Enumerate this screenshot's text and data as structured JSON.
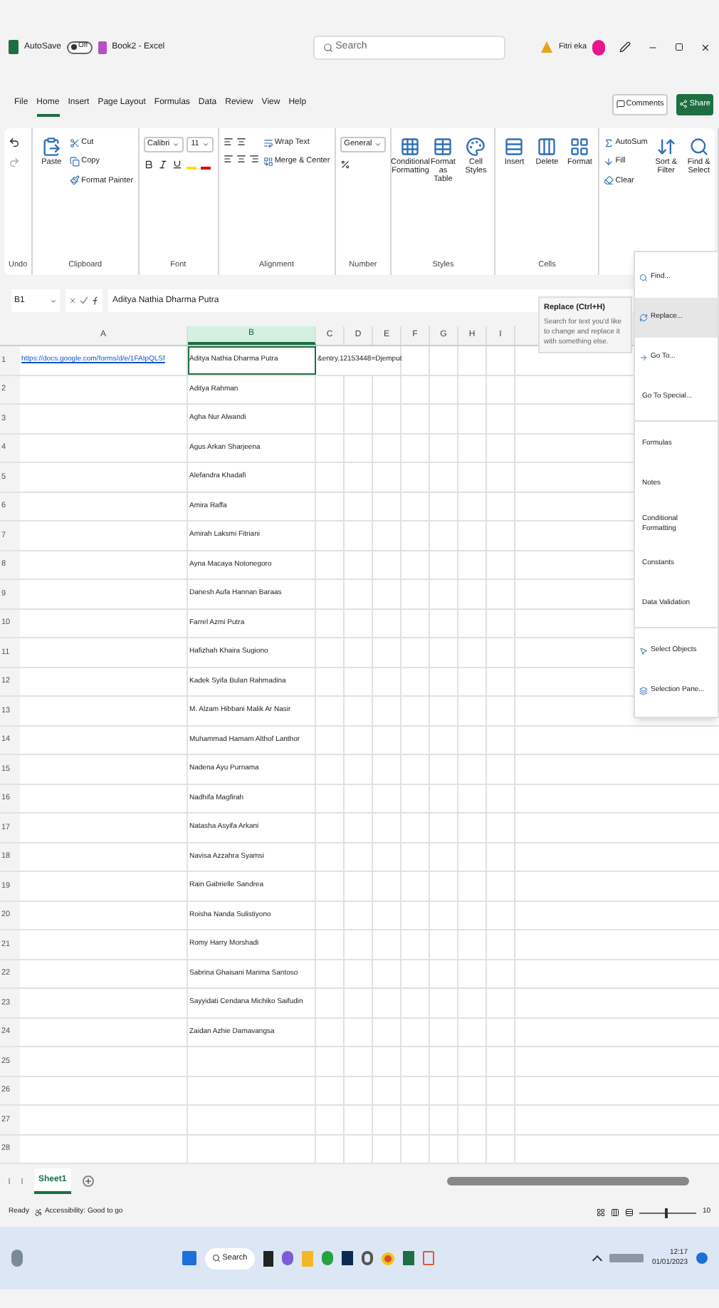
{
  "title_bar": {
    "autosave_label": "AutoSave",
    "autosave_on": false,
    "toggle_text": "Off",
    "document": "Book2 - Excel",
    "search_placeholder": "Search",
    "user": "Fitri eka"
  },
  "menu_tabs": [
    {
      "label": "File",
      "selected": false
    },
    {
      "label": "Home",
      "selected": true
    },
    {
      "label": "Insert",
      "selected": false
    },
    {
      "label": "Page Layout",
      "selected": false
    },
    {
      "label": "Formulas",
      "selected": false
    },
    {
      "label": "Data",
      "selected": false
    },
    {
      "label": "Review",
      "selected": false
    },
    {
      "label": "View",
      "selected": false
    },
    {
      "label": "Help",
      "selected": false
    }
  ],
  "comments_button": "Comments",
  "share_button": "Share",
  "ribbon_groups": [
    {
      "label": "Undo"
    },
    {
      "label": "Clipboard",
      "items": [
        {
          "label": "Paste",
          "kind": "large"
        },
        {
          "label": "Cut",
          "kind": "small"
        },
        {
          "label": "Copy",
          "kind": "small"
        },
        {
          "label": "Format Painter",
          "kind": "small"
        }
      ]
    },
    {
      "label": "Font",
      "items": [
        {
          "label": "Calibri",
          "kind": "field"
        },
        {
          "label": "11",
          "kind": "field"
        }
      ]
    },
    {
      "label": "Alignment",
      "items": [
        {
          "label": "Wrap Text",
          "kind": "small"
        },
        {
          "label": "Merge & Center",
          "kind": "small"
        }
      ]
    },
    {
      "label": "Number",
      "items": [
        {
          "label": "General",
          "kind": "field"
        }
      ]
    },
    {
      "label": "Styles",
      "items": [
        {
          "label": "Conditional Formatting",
          "kind": "large"
        },
        {
          "label": "Format as Table",
          "kind": "large"
        },
        {
          "label": "Cell Styles",
          "kind": "large"
        }
      ]
    },
    {
      "label": "Cells",
      "items": [
        {
          "label": "Insert",
          "kind": "large"
        },
        {
          "label": "Delete",
          "kind": "large"
        },
        {
          "label": "Format",
          "kind": "large"
        }
      ]
    },
    {
      "items": [
        {
          "label": "AutoSum",
          "kind": "small"
        },
        {
          "label": "Fill",
          "kind": "small"
        },
        {
          "label": "Clear",
          "kind": "small"
        },
        {
          "label": "Sort & Filter",
          "kind": "large"
        },
        {
          "label": "Find & Select",
          "kind": "large"
        }
      ]
    }
  ],
  "formula_bar": {
    "cell_ref": "B1",
    "value": "Aditya Nathia Dharma Putra"
  },
  "columns": [
    {
      "label": "A",
      "selected": false
    },
    {
      "label": "B",
      "selected": true
    },
    {
      "label": "C",
      "selected": false
    },
    {
      "label": "D",
      "selected": false
    },
    {
      "label": "E",
      "selected": false
    },
    {
      "label": "F",
      "selected": false
    },
    {
      "label": "G",
      "selected": false
    },
    {
      "label": "H",
      "selected": false
    },
    {
      "label": "I",
      "selected": false
    }
  ],
  "rows": [
    {
      "number": "1",
      "a": "https://docs.google.com/forms/d/e/1FAIpQLSf",
      "b": "Aditya Nathia Dharma Putra",
      "c": "&entry.12153448=Djemput",
      "active": true
    },
    {
      "number": "2",
      "b": "Aditya Rahman",
      "active": false
    },
    {
      "number": "3",
      "b": "Agha Nur Alwandi",
      "active": false
    },
    {
      "number": "4",
      "b": "Agus Arkan Sharjeena",
      "active": false
    },
    {
      "number": "5",
      "b": "Alefandra Khadafi",
      "active": false
    },
    {
      "number": "6",
      "b": "Amira Raffa",
      "active": false
    },
    {
      "number": "7",
      "b": "Amirah Laksmi Fitriani",
      "active": false
    },
    {
      "number": "8",
      "b": "Ayna Macaya Notonegoro",
      "active": false
    },
    {
      "number": "9",
      "b": "Danesh Aufa Hannan Baraas",
      "active": false
    },
    {
      "number": "10",
      "b": "Farrel Azmi Putra",
      "active": false
    },
    {
      "number": "11",
      "b": "Hafizhah Khaira Sugiono",
      "active": false
    },
    {
      "number": "12",
      "b": "Kadek Syifa Bulan Rahmadina",
      "active": false
    },
    {
      "number": "13",
      "b": "M. Alzam Hibbani Malik Ar Nasir",
      "active": false
    },
    {
      "number": "14",
      "b": "Muhammad Hamam Althof Lanthor",
      "active": false
    },
    {
      "number": "15",
      "b": "Nadena Ayu Purnama",
      "active": false
    },
    {
      "number": "16",
      "b": "Nadhifa Magfirah",
      "active": false
    },
    {
      "number": "17",
      "b": "Natasha Asyifa Arkani",
      "active": false
    },
    {
      "number": "18",
      "b": "Navisa Azzahra Syamsi",
      "active": false
    },
    {
      "number": "19",
      "b": "Rain Gabrielle Sandrea",
      "active": false
    },
    {
      "number": "20",
      "b": "Roisha Nanda Sulistiyono",
      "active": false
    },
    {
      "number": "21",
      "b": "Romy Harry Morshadi",
      "active": false
    },
    {
      "number": "22",
      "b": "Sabrina Ghaisani Marima Santoso",
      "active": false
    },
    {
      "number": "23",
      "b": "Sayyidati Cendana Michiko Saifudin",
      "active": false
    },
    {
      "number": "24",
      "b": "Zaidan Azhie Damavangsa",
      "active": false
    },
    {
      "number": "25",
      "active": false
    },
    {
      "number": "26",
      "active": false
    },
    {
      "number": "27",
      "active": false
    },
    {
      "number": "28",
      "active": false
    }
  ],
  "tooltip": {
    "title": "Replace (Ctrl+H)",
    "text": "Search for text you'd like to change and replace it with something else."
  },
  "find_menu": [
    {
      "label": "Find...",
      "kind": "icon",
      "selected": false
    },
    {
      "label": "Replace...",
      "kind": "icon",
      "selected": true
    },
    {
      "label": "Go To...",
      "kind": "icon",
      "selected": false
    },
    {
      "label": "Go To Special...",
      "kind": "plain",
      "selected": false
    },
    {
      "label": "Formulas",
      "kind": "plain",
      "selected": false
    },
    {
      "label": "Notes",
      "kind": "plain",
      "selected": false
    },
    {
      "label": "Conditional Formatting",
      "kind": "plain",
      "selected": false
    },
    {
      "label": "Constants",
      "kind": "plain",
      "selected": false
    },
    {
      "label": "Data Validation",
      "kind": "plain",
      "selected": false
    },
    {
      "label": "Select Objects",
      "kind": "icon",
      "selected": false
    },
    {
      "label": "Selection Pane...",
      "kind": "icon",
      "selected": false
    }
  ],
  "sheet_tabs": [
    {
      "label": "Sheet1",
      "selected": true
    }
  ],
  "status_bar": {
    "ready": "Ready",
    "accessibility": "Accessibility: Good to go",
    "zoom": "10",
    "zoom_slider": {
      "level": 0.45
    }
  },
  "taskbar": {
    "search": "Search",
    "time": "12:17",
    "date": "01/01/2023"
  }
}
